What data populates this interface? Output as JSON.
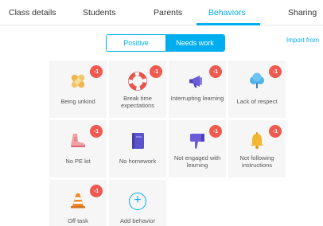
{
  "tabs": [
    {
      "label": "Class details"
    },
    {
      "label": "Students"
    },
    {
      "label": "Parents"
    },
    {
      "label": "Behaviors",
      "active": true
    },
    {
      "label": "Sharing"
    }
  ],
  "toggle": {
    "positive": "Positive",
    "needs_work": "Needs work",
    "selected": "Needs work"
  },
  "import_link": "Import from",
  "behaviors": [
    {
      "label": "Being unkind",
      "points": "-1",
      "icon": "bandage-icon"
    },
    {
      "label": "Break time expectations",
      "points": "-1",
      "icon": "lifebuoy-icon"
    },
    {
      "label": "Interrupting learning",
      "points": "-1",
      "icon": "megaphone-icon"
    },
    {
      "label": "Lack of respect",
      "points": "-1",
      "icon": "tree-icon"
    },
    {
      "label": "No PE kit",
      "points": "-1",
      "icon": "sneaker-icon"
    },
    {
      "label": "No homework",
      "points": "",
      "icon": "book-icon"
    },
    {
      "label": "Not engaged with learning",
      "points": "-1",
      "icon": "thumbs-down-icon"
    },
    {
      "label": "Not following instructions",
      "points": "-1",
      "icon": "bell-icon"
    },
    {
      "label": "Off task",
      "points": "-1",
      "icon": "traffic-cone-icon"
    }
  ],
  "add_behavior": {
    "label": "Add behavior",
    "icon": "plus-icon"
  },
  "colors": {
    "accent": "#00aeef",
    "badge": "#f0594f",
    "card": "#f6f6f6"
  }
}
